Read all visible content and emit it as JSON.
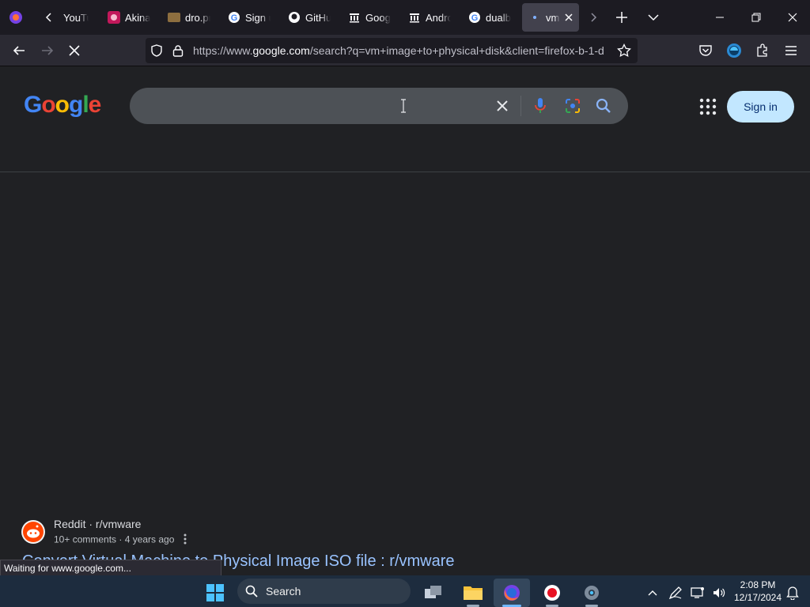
{
  "browser": {
    "tabs": [
      {
        "title": "YouTube",
        "icon": "youtube-icon"
      },
      {
        "title": "Akinator",
        "icon": "akinator-icon"
      },
      {
        "title": "dro.pro",
        "icon": "image-icon"
      },
      {
        "title": "Sign up",
        "icon": "google-icon"
      },
      {
        "title": "GitHub",
        "icon": "github-icon"
      },
      {
        "title": "Google",
        "icon": "bank-icon"
      },
      {
        "title": "Android",
        "icon": "bank-icon"
      },
      {
        "title": "dualboot",
        "icon": "google-icon"
      },
      {
        "title": "vm",
        "icon": "loading-icon",
        "active": true
      }
    ],
    "url_prefix": "https://www.",
    "url_domain": "google.com",
    "url_rest": "/search?q=vm+image+to+physical+disk&client=firefox-b-1-d",
    "status_text": "Waiting for www.google.com..."
  },
  "google": {
    "search_value": "",
    "signin_label": "Sign in"
  },
  "result": {
    "source": "Reddit · r/vmware",
    "meta": "10+ comments · 4 years ago",
    "title": "Convert Virtual Machine to Physical Image ISO file : r/vmware"
  },
  "taskbar": {
    "search_label": "Search",
    "time": "2:08 PM",
    "date": "12/17/2024"
  }
}
